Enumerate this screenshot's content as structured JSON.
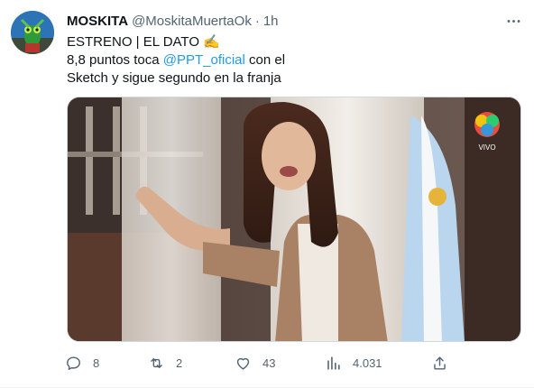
{
  "tweet": {
    "name": "MOSKITA",
    "handle": "@MoskitaMuertaOk",
    "separator": "·",
    "time": "1h",
    "line1": "ESTRENO | EL DATO ✍",
    "line2_before": "8,8 puntos toca ",
    "mention": "@PPT_oficial",
    "line2_after": " con el",
    "line3": "Sketch y sigue segundo en la franja",
    "media_badge": "VIVO"
  },
  "actions": {
    "replies": "8",
    "retweets": "2",
    "likes": "43",
    "views": "4.031"
  },
  "icons": [
    "more-icon",
    "reply-icon",
    "retweet-icon",
    "like-icon",
    "views-icon",
    "share-icon"
  ],
  "colors": {
    "link": "#1d9bf0",
    "muted": "#536471",
    "text": "#0f1419"
  }
}
